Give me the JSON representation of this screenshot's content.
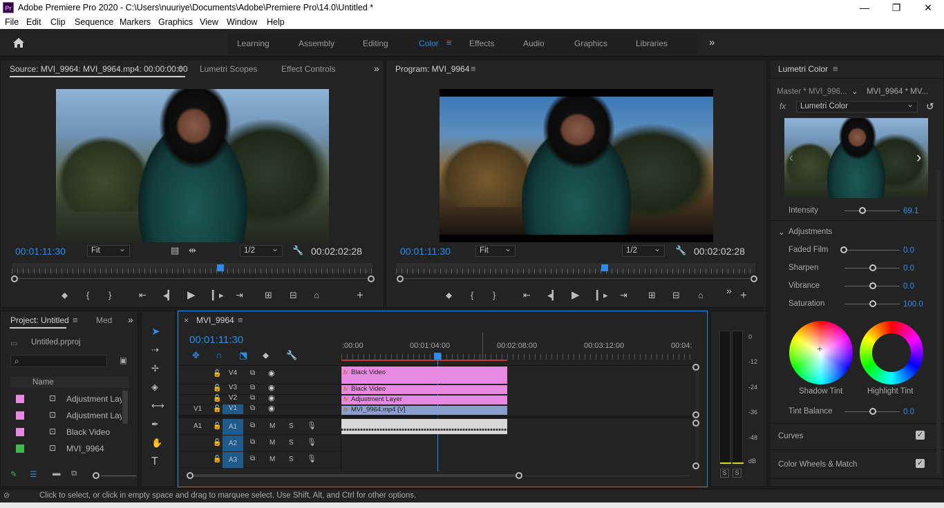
{
  "app": {
    "title": "Adobe Premiere Pro 2020 - C:\\Users\\nuuriye\\Documents\\Adobe\\Premiere Pro\\14.0\\Untitled *",
    "logo": "Pr"
  },
  "window_controls": {
    "minimize": "—",
    "maximize": "❐",
    "close": "✕"
  },
  "menu": [
    "File",
    "Edit",
    "Clip",
    "Sequence",
    "Markers",
    "Graphics",
    "View",
    "Window",
    "Help"
  ],
  "workspaces": {
    "items": [
      "Learning",
      "Assembly",
      "Editing",
      "Color",
      "Effects",
      "Audio",
      "Graphics",
      "Libraries"
    ],
    "active": "Color",
    "more": "»"
  },
  "source": {
    "tabs": [
      "Source: MVI_9964: MVI_9964.mp4: 00:00:00:00",
      "Lumetri Scopes",
      "Effect Controls"
    ],
    "timecode": "00:01:11:30",
    "fit": "Fit",
    "resolution": "1/2",
    "duration": "00:02:02:28"
  },
  "program": {
    "tab": "Program: MVI_9964",
    "timecode": "00:01:11:30",
    "fit": "Fit",
    "resolution": "1/2",
    "duration": "00:02:02:28"
  },
  "project": {
    "tab": "Project: Untitled",
    "tab2": "Med",
    "file": "Untitled.prproj",
    "column": "Name",
    "items": [
      {
        "name": "Adjustment Layer",
        "color": "#e58ae0"
      },
      {
        "name": "Adjustment Layer",
        "color": "#e58ae0"
      },
      {
        "name": "Black Video",
        "color": "#e58ae0"
      },
      {
        "name": "MVI_9964",
        "color": "#3dbb4a"
      }
    ]
  },
  "timeline": {
    "tab": "MVI_9964",
    "timecode": "00:01:11:30",
    "ruler": [
      ":00:00",
      "00:01:04:00",
      "00:02:08:00",
      "00:03:12:00",
      "00:04:"
    ],
    "video_tracks": [
      {
        "label": "V4",
        "target": "V4"
      },
      {
        "label": "V3",
        "target": "V3"
      },
      {
        "label": "V2",
        "target": "V2"
      },
      {
        "label": "V1",
        "target": "V1",
        "source": "V1"
      }
    ],
    "audio_tracks": [
      {
        "label": "A1",
        "source": "A1"
      },
      {
        "label": "A2"
      },
      {
        "label": "A3"
      }
    ],
    "mute": "M",
    "solo": "S",
    "clips": {
      "v4": "Black Video",
      "v3": "Black Video",
      "v2": "Adjustment Layer",
      "v1": "MVI_9964.mp4 [V]"
    }
  },
  "audio_meter": {
    "scale": [
      "0",
      "-12",
      "-24",
      "-36",
      "-48",
      "dB"
    ],
    "solo_left": "S",
    "solo_right": "S"
  },
  "lumetri": {
    "tab": "Lumetri Color",
    "master": "Master * MVI_996...",
    "clip": "MVI_9964 * MV...",
    "fx_label": "fx",
    "effect": "Lumetri Color",
    "intensity_label": "Intensity",
    "intensity": "69.1",
    "adjustments_label": "Adjustments",
    "adjustments": [
      {
        "label": "Faded Film",
        "value": "0.0",
        "level": 0
      },
      {
        "label": "Sharpen",
        "value": "0.0",
        "level": 0.5
      },
      {
        "label": "Vibrance",
        "value": "0.0",
        "level": 0.5
      },
      {
        "label": "Saturation",
        "value": "100.0",
        "level": 0.5
      }
    ],
    "shadow_tint": "Shadow Tint",
    "highlight_tint": "Highlight Tint",
    "tint_balance_label": "Tint Balance",
    "tint_balance": "0.0",
    "sections": [
      "Curves",
      "Color Wheels & Match"
    ]
  },
  "status": "Click to select, or click in empty space and drag to marquee select. Use Shift, Alt, and Ctrl for other options.",
  "colors": {
    "accent": "#2d8ceb",
    "clip_pink": "#e58ae0",
    "playhead": "#2d8ceb"
  }
}
